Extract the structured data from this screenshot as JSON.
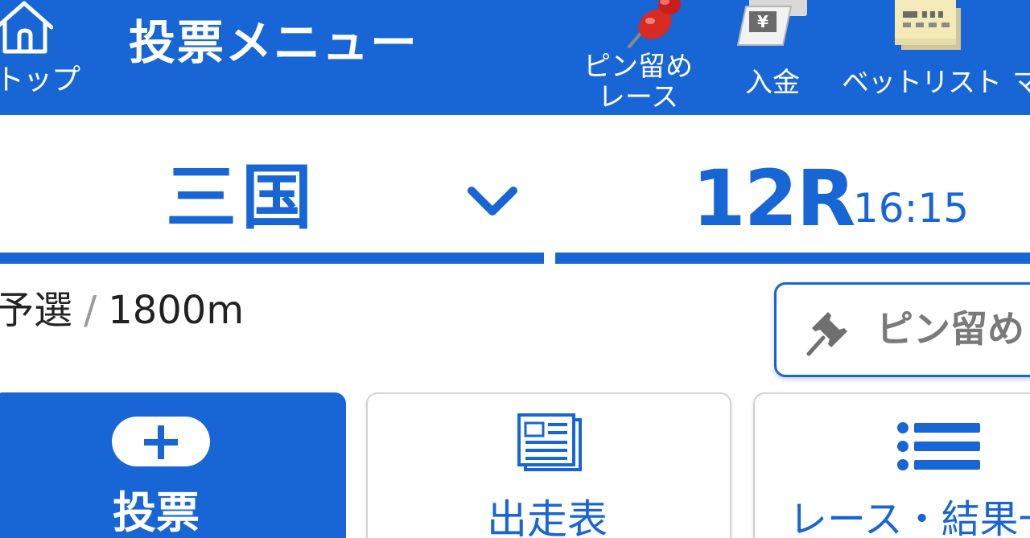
{
  "header": {
    "home_label": "トップ",
    "title": "投票メニュー",
    "items": [
      {
        "label": "ピン留め",
        "label2": "レース",
        "icon": "red-pushpin-icon"
      },
      {
        "label": "入金",
        "icon": "deposit-ticket-icon"
      },
      {
        "label": "ベットリスト",
        "icon": "bet-tickets-icon"
      },
      {
        "label": "マ",
        "icon": ""
      }
    ]
  },
  "selectors": {
    "venue": "三国",
    "race_number": "12R",
    "post_time": "16:15"
  },
  "race_info": {
    "class": "予選",
    "separator": "/",
    "distance": "1800m"
  },
  "pin_button": {
    "label": "ピン留め"
  },
  "cards": {
    "vote": "投票",
    "entry": "出走表",
    "results": "レース・結果一"
  },
  "colors": {
    "primary": "#1865d6",
    "white": "#ffffff",
    "gray_text": "#7a7a7a"
  }
}
